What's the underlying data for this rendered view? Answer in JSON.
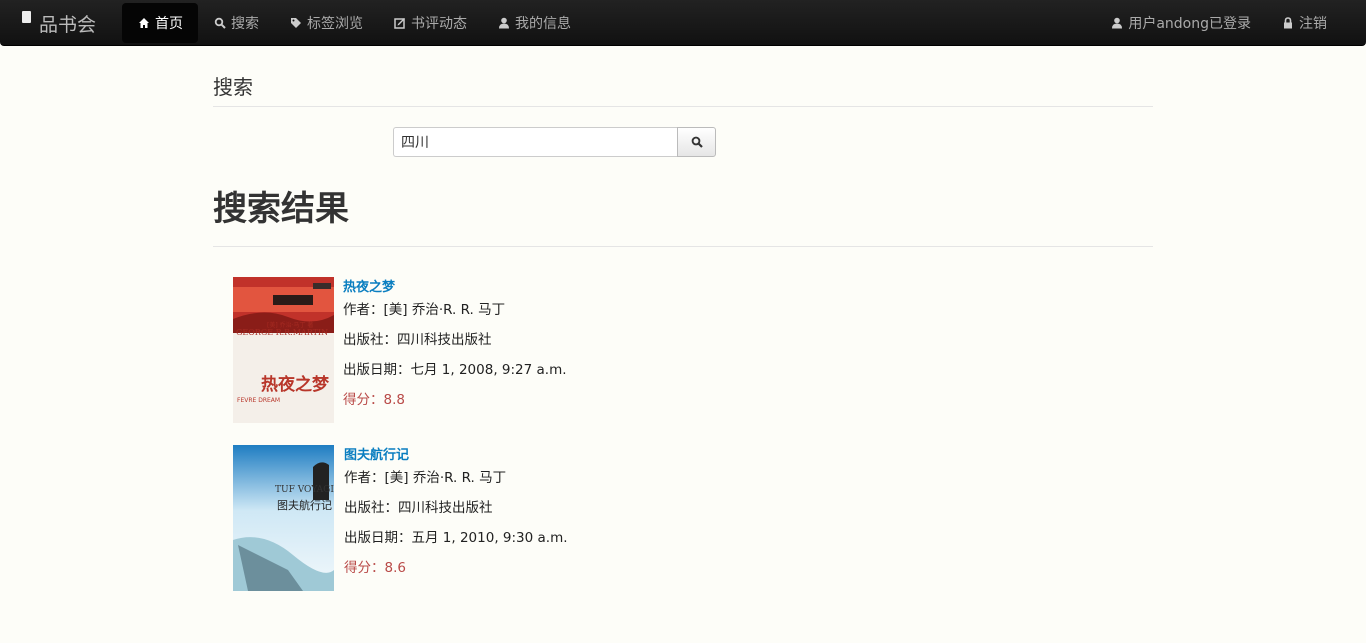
{
  "navbar": {
    "brand": "品书会",
    "items": [
      {
        "label": "首页",
        "icon": "home-icon",
        "active": true
      },
      {
        "label": "搜索",
        "icon": "search-icon"
      },
      {
        "label": "标签浏览",
        "icon": "tag-icon"
      },
      {
        "label": "书评动态",
        "icon": "edit-icon"
      },
      {
        "label": "我的信息",
        "icon": "user-icon"
      }
    ],
    "right_items": [
      {
        "label": "用户andong已登录",
        "icon": "user-icon"
      },
      {
        "label": "注销",
        "icon": "lock-icon"
      }
    ]
  },
  "search": {
    "header": "搜索",
    "value": "四川",
    "button_icon": "search-icon"
  },
  "results": {
    "header": "搜索结果",
    "books": [
      {
        "title": "热夜之梦",
        "author": "作者：[美] 乔治·R. R. 马丁",
        "publisher": "出版社：四川科技出版社",
        "date": "出版日期：七月 1, 2008, 9:27 a.m.",
        "score": "得分：8.8",
        "cover_text": "热夜之梦",
        "cover_author": "[美] 乔治·马丁 著",
        "cover_name": "GEORGE R.R.MARTIN",
        "cover_subtitle": "FEVRE DREAM"
      },
      {
        "title": "图夫航行记",
        "author": "作者：[美] 乔治·R. R. 马丁",
        "publisher": "出版社：四川科技出版社",
        "date": "出版日期：五月 1, 2010, 9:30 a.m.",
        "score": "得分：8.6",
        "cover_text": "图夫航行记",
        "cover_name": "TUF VOYAGING"
      }
    ]
  }
}
